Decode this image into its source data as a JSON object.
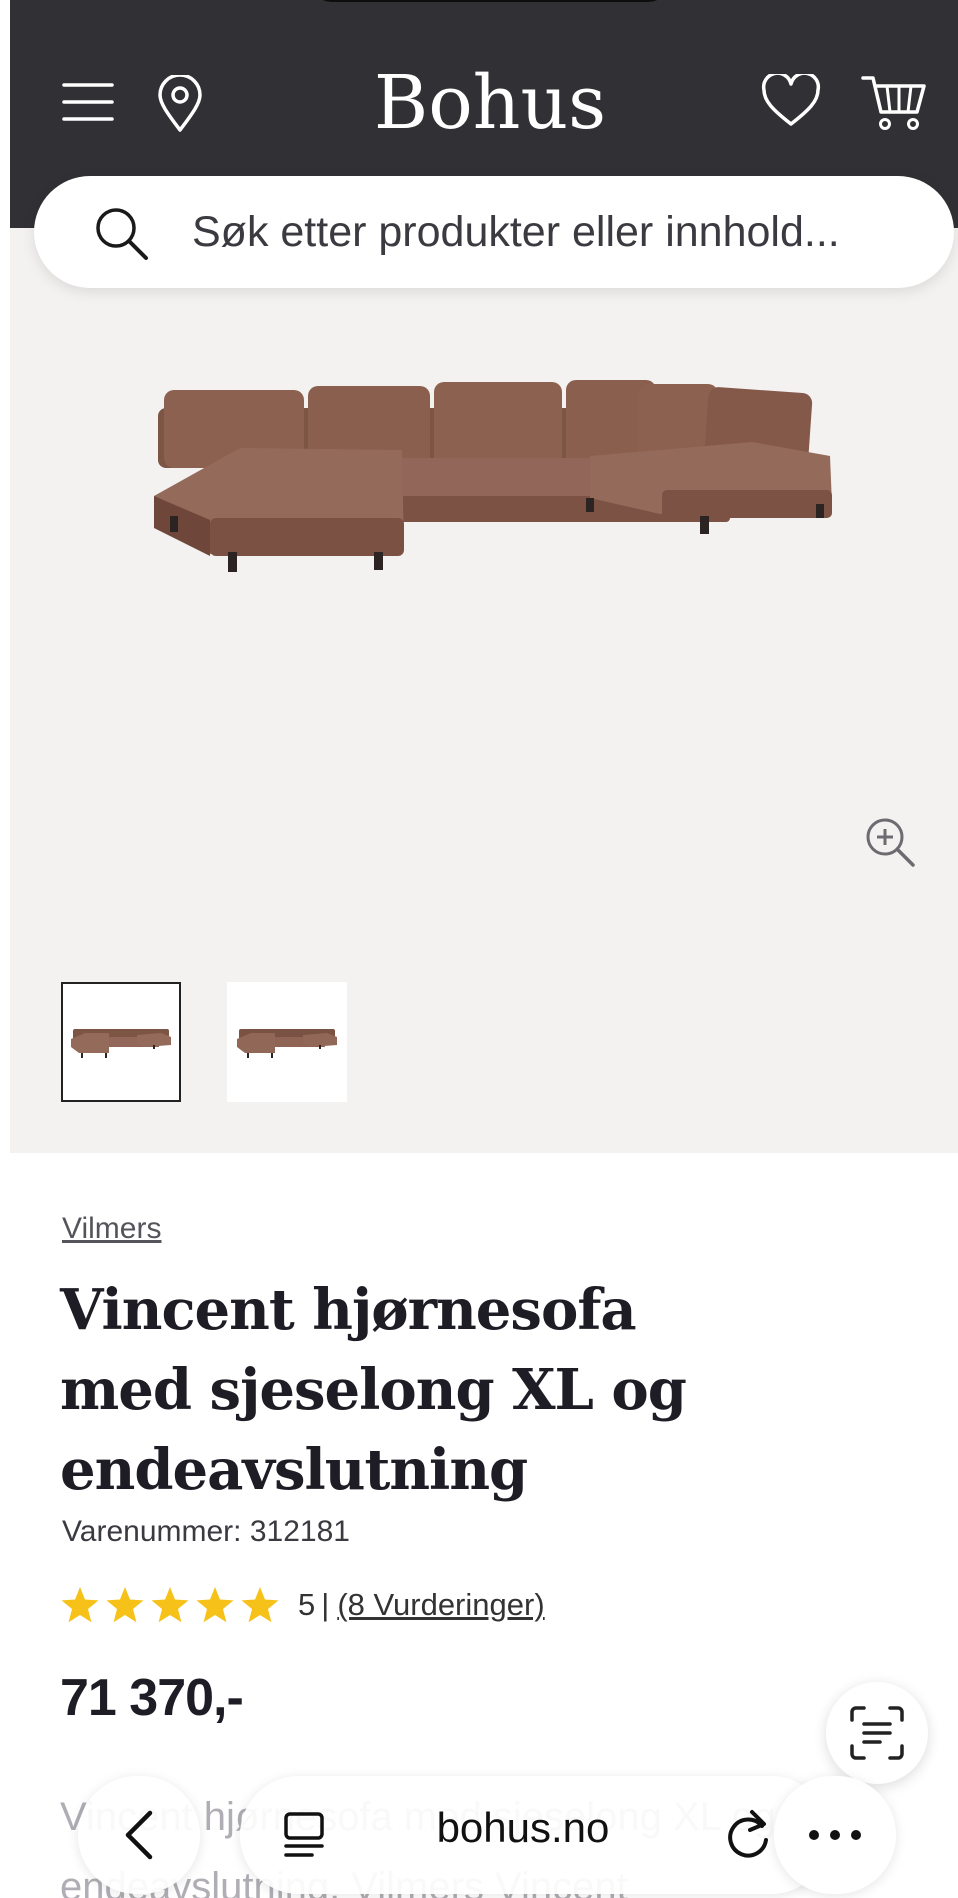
{
  "header": {
    "logo": "Bohus"
  },
  "search": {
    "placeholder": "Søk etter produkter eller innhold..."
  },
  "product": {
    "brand": "Vilmers",
    "title": "Vincent hjørnesofa med sjeselong XL og endeavslutning",
    "sku": "Varenummer: 312181",
    "rating_value": 5,
    "rating_score_text": "5",
    "rating_separator": "|",
    "reviews_link": "(8 Vurderinger)",
    "price": "71 370,-",
    "description_partial": "Vincent hjørnesofa med sjeselong XL og endeavslutning. Vilmers Vincent"
  },
  "gallery": {
    "thumbnails": [
      "sofa-view-1",
      "sofa-view-2"
    ],
    "selected_index": 0
  },
  "browser": {
    "address": "bohus.no"
  },
  "colors": {
    "header_bg": "#313034",
    "gallery_bg": "#f4f2f1",
    "sofa": "#8a5e4c",
    "star": "#f6c21a"
  },
  "icons": {
    "menu": "menu-icon",
    "location": "location-pin-icon",
    "favorite": "heart-icon",
    "cart": "cart-icon",
    "search": "search-icon",
    "zoom": "zoom-in-icon",
    "chat": "chat-icon",
    "back": "chevron-left-icon",
    "reader": "reader-icon",
    "reload": "reload-icon",
    "more": "more-icon"
  }
}
